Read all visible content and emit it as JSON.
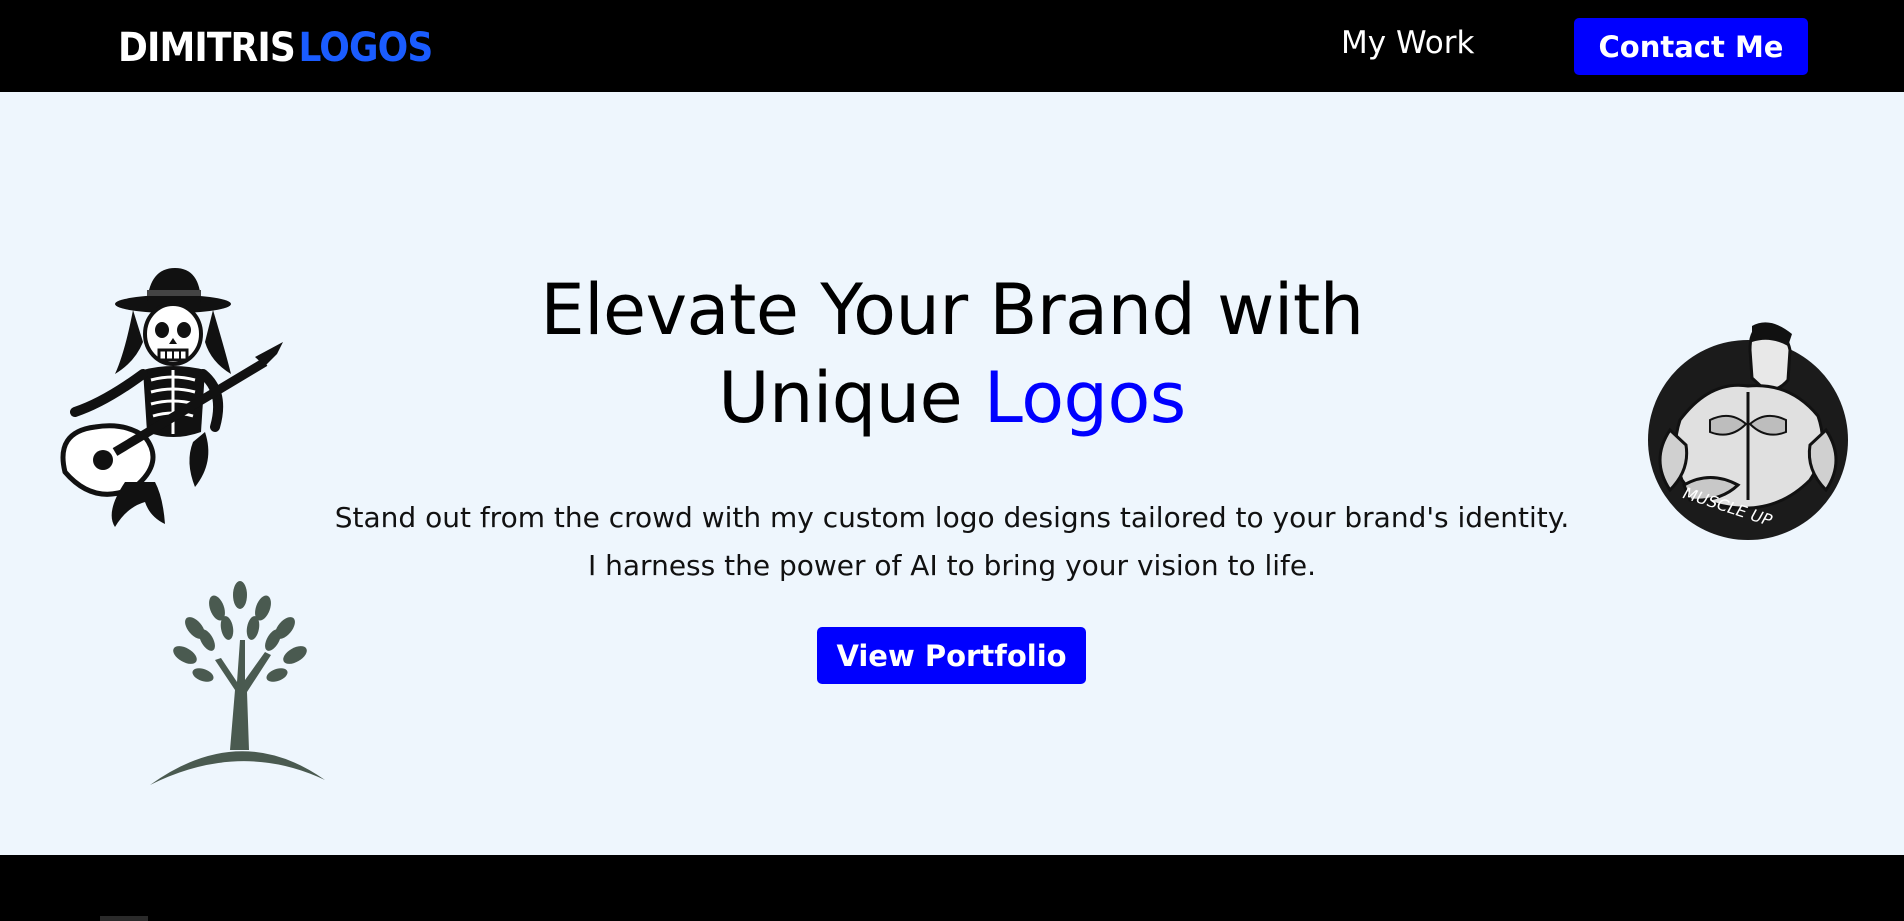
{
  "header": {
    "logo_part1": "DIMITRIS",
    "logo_part2": "LOGOS",
    "nav_my_work": "My Work",
    "contact_label": "Contact Me"
  },
  "hero": {
    "title_line1": "Elevate Your Brand with",
    "title_line2_plain": "Unique",
    "title_line2_accent": "Logos",
    "subtitle_line1": "Stand out from the crowd with my custom logo designs tailored to your brand's identity.",
    "subtitle_line2": "I harness the power of AI to bring your vision to life.",
    "cta_label": "View Portfolio"
  },
  "artwork": {
    "muscle_badge_text": "MUSCLE UP"
  },
  "colors": {
    "accent": "#0000ff",
    "logo_blue": "#1a5cff",
    "header_bg": "#000000",
    "page_bg": "#eef6fd",
    "tree_green": "#4a5a50"
  }
}
